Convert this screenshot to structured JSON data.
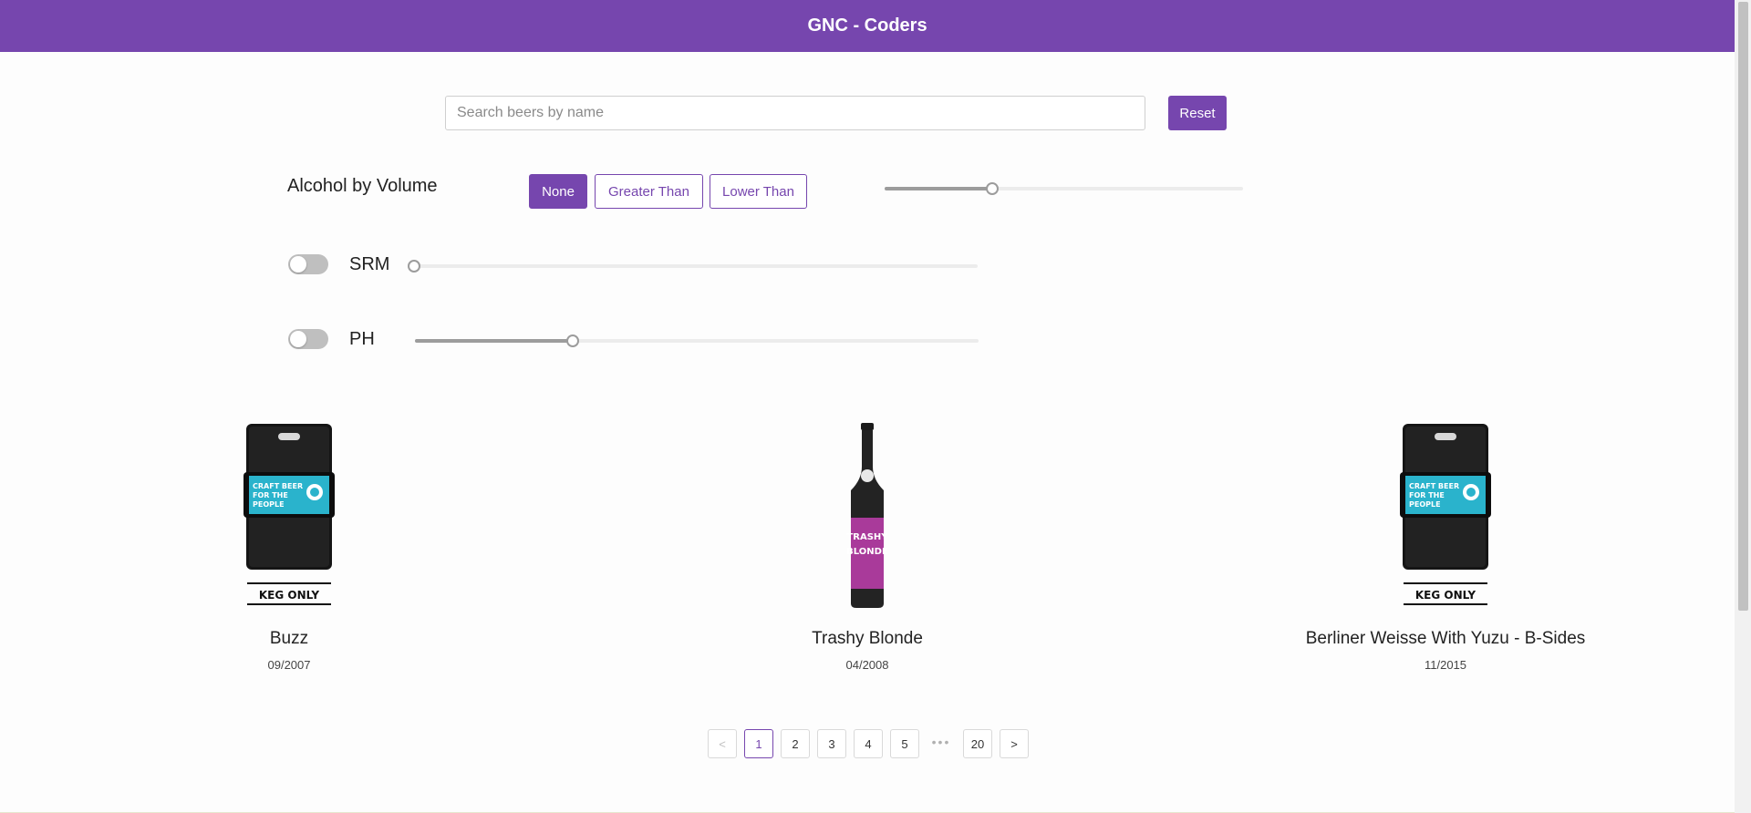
{
  "header": {
    "title": "GNC - Coders",
    "background": "#7646ae"
  },
  "search": {
    "placeholder": "Search beers by name",
    "value": "",
    "reset_label": "Reset"
  },
  "filters": {
    "abv": {
      "label": "Alcohol by Volume",
      "modes": [
        "None",
        "Greater Than",
        "Lower Than"
      ],
      "selected_mode": "None",
      "slider_fraction": 0.3
    },
    "srm": {
      "label": "SRM",
      "enabled": false,
      "slider_fraction": 0.0
    },
    "ph": {
      "label": "PH",
      "enabled": false,
      "slider_fraction": 0.28
    }
  },
  "beers": [
    {
      "name": "Buzz",
      "date": "09/2007",
      "image_icon": "keg-icon",
      "keg_label": "KEG ONLY",
      "label_text": "CRAFT BEER FOR THE PEOPLE"
    },
    {
      "name": "Trashy Blonde",
      "date": "04/2008",
      "image_icon": "bottle-icon",
      "label_text": "TRASHY BLONDE"
    },
    {
      "name": "Berliner Weisse With Yuzu - B-Sides",
      "date": "11/2015",
      "image_icon": "keg-icon",
      "keg_label": "KEG ONLY",
      "label_text": "CRAFT BEER FOR THE PEOPLE"
    }
  ],
  "pagination": {
    "prev": "<",
    "next": ">",
    "pages": [
      "1",
      "2",
      "3",
      "4",
      "5"
    ],
    "ellipsis": "•••",
    "last": "20",
    "current": "1"
  },
  "colors": {
    "accent": "#7646ae",
    "slider_track": "#9c9c9c",
    "toggle_off": "#bfbfbf"
  }
}
